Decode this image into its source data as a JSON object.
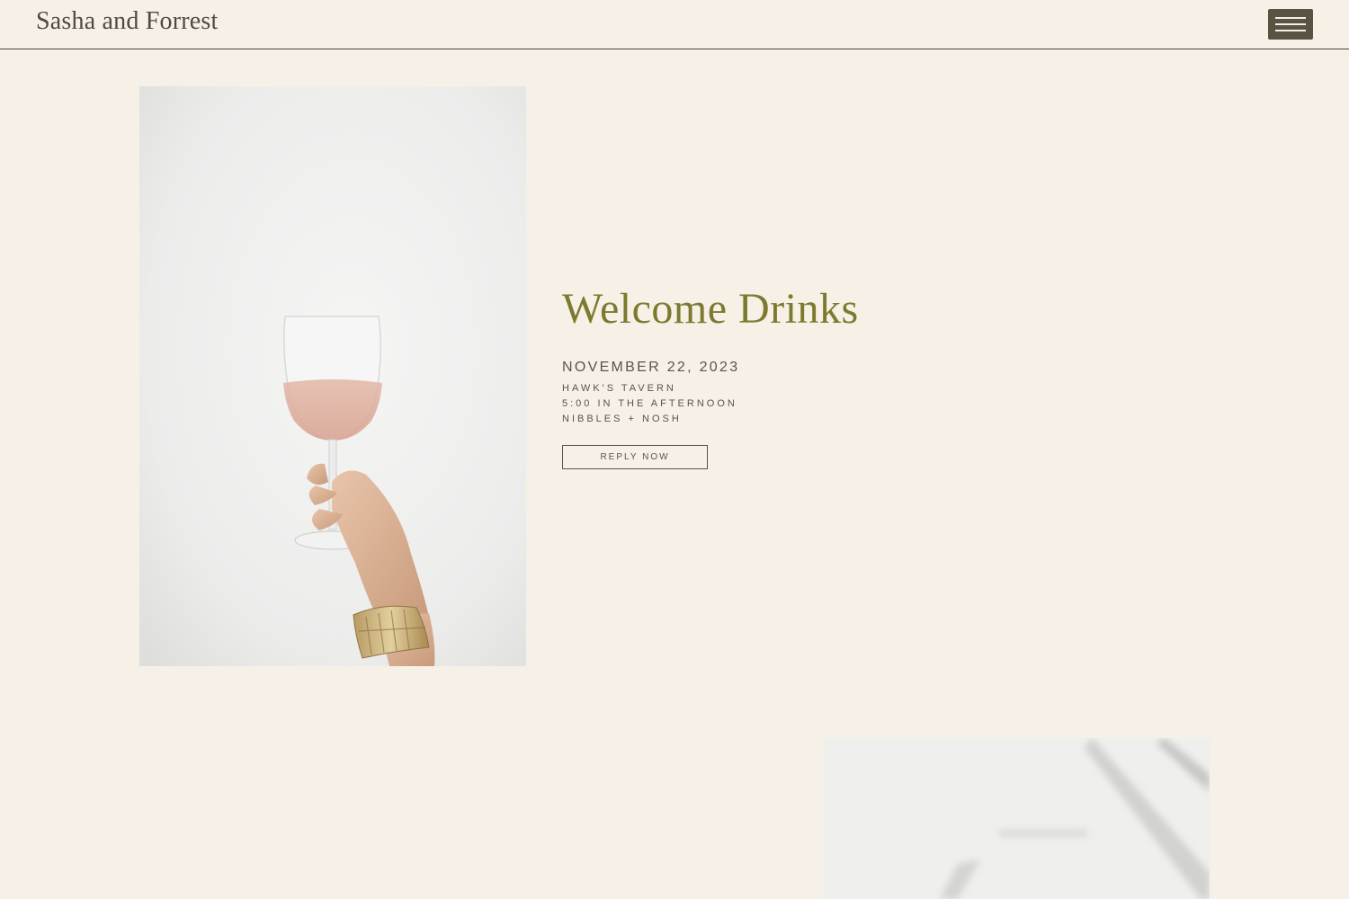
{
  "header": {
    "brand": "Sasha and Forrest",
    "menu_icon": "hamburger-menu-icon"
  },
  "event": {
    "title": "Welcome Drinks",
    "date": "NOVEMBER 22, 2023",
    "details": [
      "HAWK'S TAVERN",
      "5:00 IN THE AFTERNOON",
      "NIBBLES + NOSH"
    ],
    "cta_label": "REPLY NOW"
  },
  "images": {
    "primary": "hand-holding-rose-wine-glass-photo",
    "secondary": "blurred-paper-shadow-photo"
  },
  "colors": {
    "background": "#f6f0e7",
    "accent_title": "#7c7a2e",
    "text": "#5a5549",
    "menu_button": "#5a5343"
  }
}
